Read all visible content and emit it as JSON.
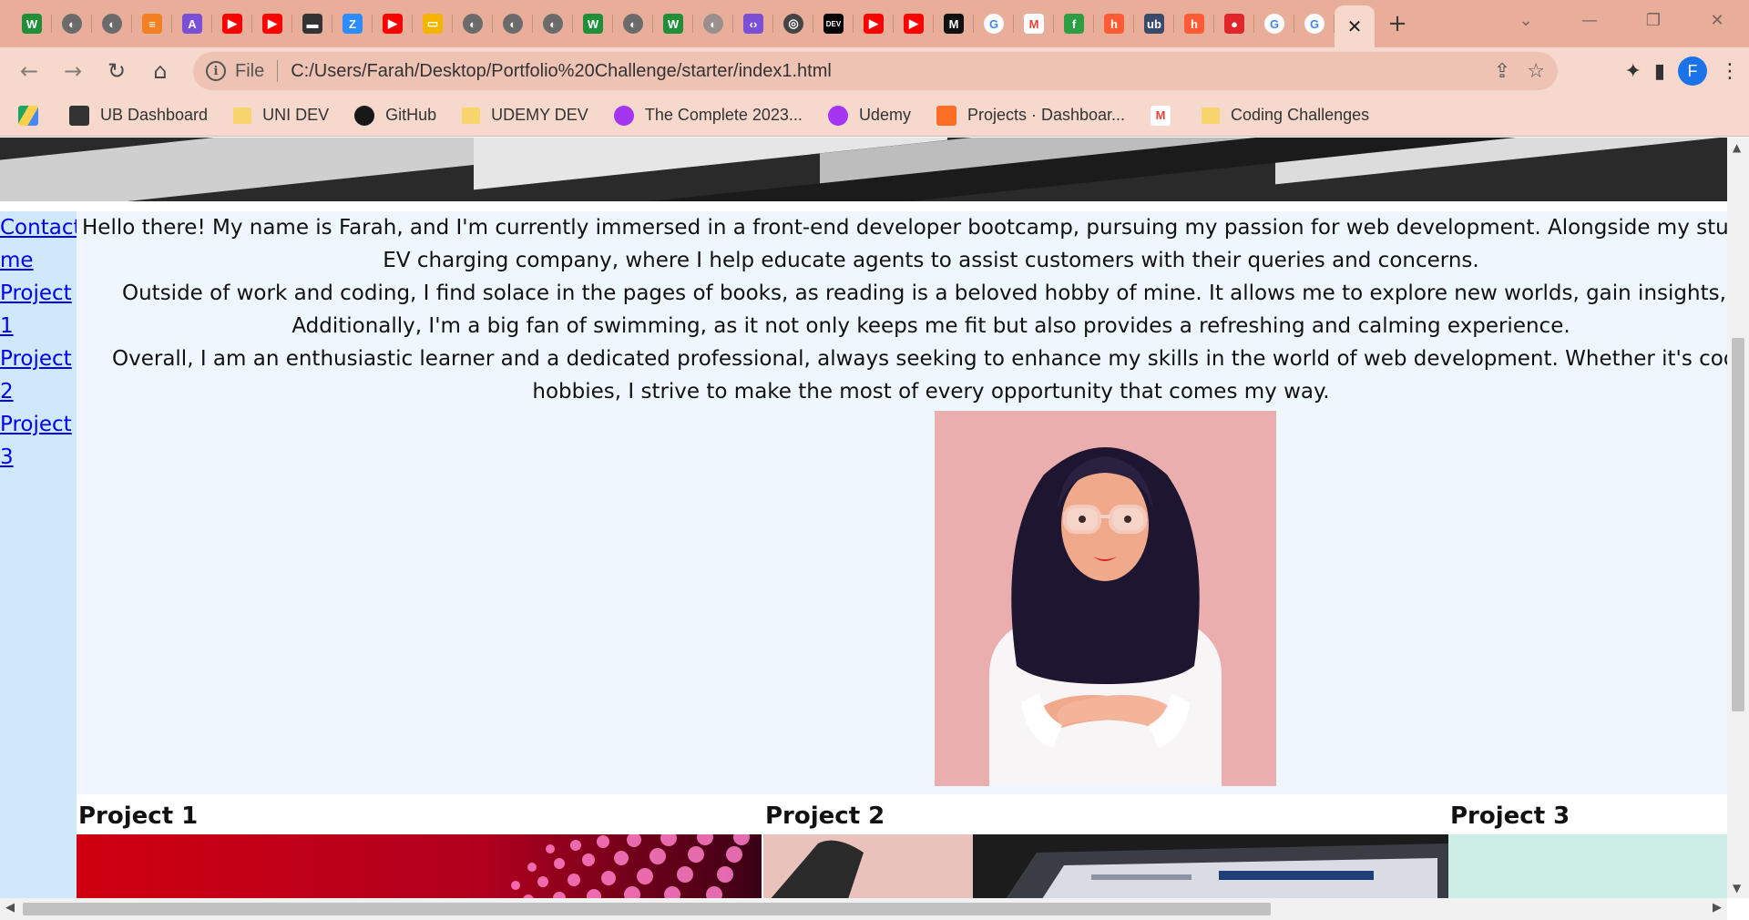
{
  "browser": {
    "tabs": [
      {
        "icon": "w-icon",
        "glyph": "W",
        "color": "#1f8f3a"
      },
      {
        "icon": "globe-icon",
        "glyph": "◐",
        "color": "#6b6b6b"
      },
      {
        "icon": "globe-icon",
        "glyph": "◐",
        "color": "#6b6b6b"
      },
      {
        "icon": "stackoverflow-icon",
        "glyph": "≡",
        "color": "#f48024"
      },
      {
        "icon": "rocket-icon",
        "glyph": "A",
        "color": "#7b4fd6"
      },
      {
        "icon": "youtube-icon",
        "glyph": "▶",
        "color": "#ff0000"
      },
      {
        "icon": "youtube-icon",
        "glyph": "▶",
        "color": "#ff0000"
      },
      {
        "icon": "terminal-icon",
        "glyph": "▬",
        "color": "#333333"
      },
      {
        "icon": "zoom-icon",
        "glyph": "Z",
        "color": "#2d8cff"
      },
      {
        "icon": "youtube-icon",
        "glyph": "▶",
        "color": "#ff0000"
      },
      {
        "icon": "slides-icon",
        "glyph": "▭",
        "color": "#f4b400"
      },
      {
        "icon": "globe-icon",
        "glyph": "◐",
        "color": "#6b6b6b"
      },
      {
        "icon": "globe-icon",
        "glyph": "◐",
        "color": "#6b6b6b"
      },
      {
        "icon": "globe-icon",
        "glyph": "◐",
        "color": "#6b6b6b"
      },
      {
        "icon": "w-icon",
        "glyph": "W",
        "color": "#1f8f3a"
      },
      {
        "icon": "globe-icon",
        "glyph": "◐",
        "color": "#6b6b6b"
      },
      {
        "icon": "w-icon",
        "glyph": "W",
        "color": "#1f8f3a"
      },
      {
        "icon": "globe-icon",
        "glyph": "◐",
        "color": "#9a8f8c"
      },
      {
        "icon": "code-icon",
        "glyph": "‹›",
        "color": "#7b4fd6"
      },
      {
        "icon": "chrome-icon",
        "glyph": "◎",
        "color": "#444444"
      },
      {
        "icon": "dev-icon",
        "glyph": "DEV",
        "color": "#000000"
      },
      {
        "icon": "youtube-icon",
        "glyph": "▶",
        "color": "#ff0000"
      },
      {
        "icon": "youtube-icon",
        "glyph": "▶",
        "color": "#ff0000"
      },
      {
        "icon": "medium-icon",
        "glyph": "M",
        "color": "#111111"
      },
      {
        "icon": "google-icon",
        "glyph": "G",
        "color": "#4285f4"
      },
      {
        "icon": "gmail-icon",
        "glyph": "M",
        "color": "#ea4335"
      },
      {
        "icon": "leaf-icon",
        "glyph": "f",
        "color": "#2e9e44"
      },
      {
        "icon": "hubspot-icon",
        "glyph": "h",
        "color": "#ff5c35"
      },
      {
        "icon": "ub-icon",
        "glyph": "ub",
        "color": "#3a4a6b"
      },
      {
        "icon": "hubspot-icon",
        "glyph": "h",
        "color": "#ff5c35"
      },
      {
        "icon": "record-icon",
        "glyph": "●",
        "color": "#e0252b"
      },
      {
        "icon": "google-icon",
        "glyph": "G",
        "color": "#4285f4"
      },
      {
        "icon": "google-icon",
        "glyph": "G",
        "color": "#4285f4"
      }
    ],
    "address": {
      "scheme_label": "File",
      "url": "C:/Users/Farah/Desktop/Portfolio%20Challenge/starter/index1.html"
    },
    "profile_initial": "F",
    "bookmarks": [
      {
        "icon": "drive-icon",
        "label": ""
      },
      {
        "icon": "ub-dashboard-icon",
        "label": "UB Dashboard"
      },
      {
        "icon": "folder-icon",
        "label": "UNI DEV"
      },
      {
        "icon": "github-icon",
        "label": "GitHub"
      },
      {
        "icon": "folder-icon",
        "label": "UDEMY DEV"
      },
      {
        "icon": "udemy-icon",
        "label": "The Complete 2023..."
      },
      {
        "icon": "udemy-icon",
        "label": "Udemy"
      },
      {
        "icon": "gitlab-icon",
        "label": "Projects · Dashboar..."
      },
      {
        "icon": "gmail-icon",
        "label": ""
      },
      {
        "icon": "folder-icon",
        "label": "Coding Challenges"
      }
    ]
  },
  "page": {
    "nav": [
      "Contact",
      "me",
      "Project",
      "1",
      "Project",
      "2",
      "Project",
      "3"
    ],
    "about": [
      "Hello there! My name is Farah, and I'm currently immersed in a front-end developer bootcamp, pursuing my passion for web development. Alongside my studies, I also",
      "EV charging company, where I help educate agents to assist customers with their queries and concerns.",
      "Outside of work and coding, I find solace in the pages of books, as reading is a beloved hobby of mine. It allows me to explore new worlds, gain insights, and expar",
      "Additionally, I'm a big fan of swimming, as it not only keeps me fit but also provides a refreshing and calming experience.",
      "Overall, I am an enthusiastic learner and a dedicated professional, always seeking to enhance my skills in the world of web development. Whether it's coding, helpi",
      "hobbies, I strive to make the most of every opportunity that comes my way."
    ],
    "projects": [
      "Project 1",
      "Project 2",
      "Project 3"
    ]
  }
}
